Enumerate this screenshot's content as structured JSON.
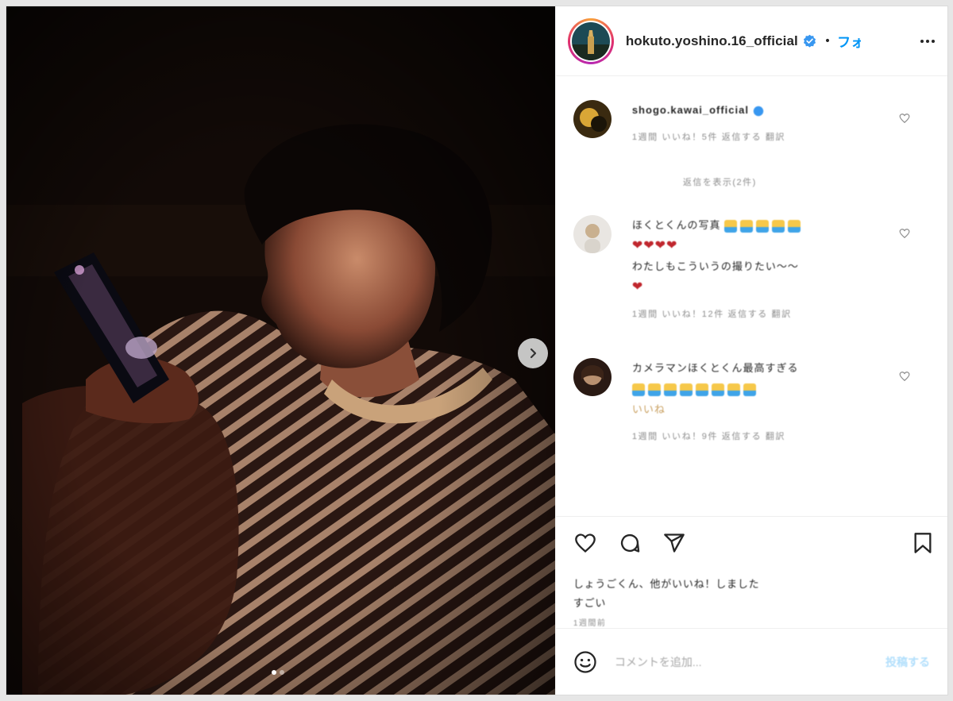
{
  "header": {
    "username": "hokuto.yoshino.16_official",
    "separator": "•",
    "follow_label": "フォロー"
  },
  "comments": [
    {
      "username": "shogo.kawai_official",
      "text": "",
      "meta": "1週間 いいね！5件 返信する 翻訳",
      "view_replies": "返信を表示(2件)"
    },
    {
      "username": "",
      "text": "ほくとくんの写真",
      "text2": "",
      "text3": "わたしもこういうの撮りたい～～",
      "meta": "1週間 いいね！12件 返信する 翻訳"
    },
    {
      "username": "",
      "text": "カメラマンほくとくん最高すぎる",
      "text2": "いいね",
      "meta": "1週間 いいね！9件 返信する 翻訳"
    }
  ],
  "likes": {
    "text": "しょうごくん、他がいいね！しました",
    "text2": "すごい"
  },
  "date": "1週間前",
  "add_comment": {
    "placeholder": "コメントを追加...",
    "post_label": "投稿する"
  },
  "carousel": {
    "total": 2,
    "active": 1
  },
  "icons": [
    "verified-badge-icon",
    "more-options-icon",
    "heart-icon",
    "comment-icon",
    "share-icon",
    "bookmark-icon",
    "emoji-icon",
    "chevron-right-icon"
  ]
}
